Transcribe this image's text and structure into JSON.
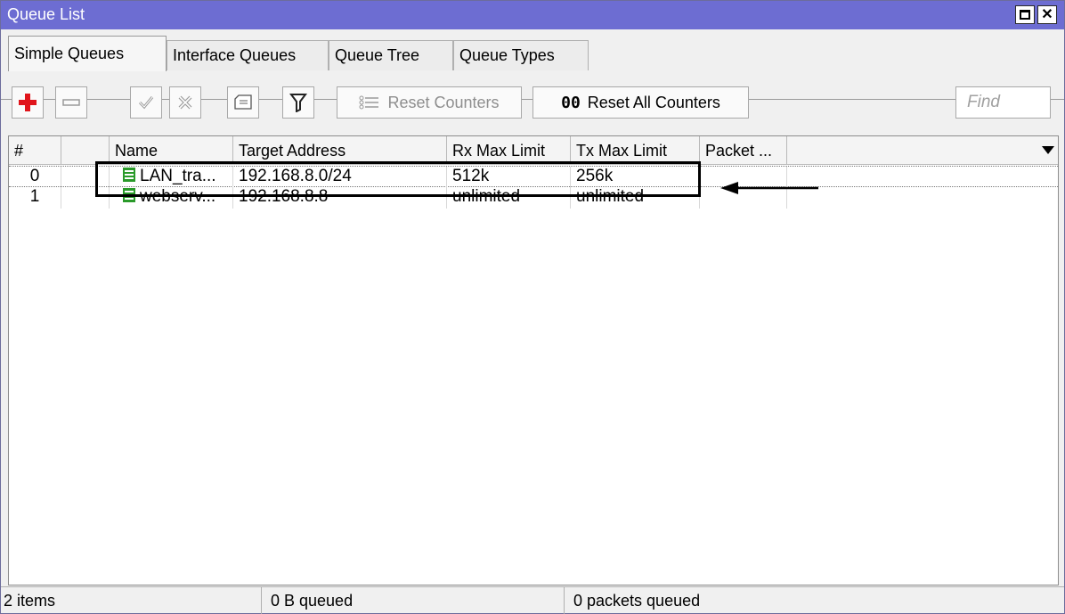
{
  "window": {
    "title": "Queue List"
  },
  "tabs": [
    {
      "label": "Simple Queues",
      "active": true
    },
    {
      "label": "Interface Queues",
      "active": false
    },
    {
      "label": "Queue Tree",
      "active": false
    },
    {
      "label": "Queue Types",
      "active": false
    }
  ],
  "toolbar": {
    "add_icon": "plus-icon",
    "remove_icon": "minus-icon",
    "enable_icon": "check-icon",
    "disable_icon": "cross-icon",
    "comment_icon": "comment-icon",
    "filter_icon": "filter-icon",
    "reset_counters_label": "Reset Counters",
    "reset_all_prefix": "00",
    "reset_all_label": "Reset All Counters",
    "find_placeholder": "Find"
  },
  "table": {
    "columns": [
      "#",
      "",
      "Name",
      "Target Address",
      "Rx Max Limit",
      "Tx Max Limit",
      "Packet ..."
    ],
    "rows": [
      {
        "num": "0",
        "name": "LAN_tra...",
        "target": "192.168.8.0/24",
        "rx": "512k",
        "tx": "256k",
        "packet": ""
      },
      {
        "num": "1",
        "name": "webserv...",
        "target": "192.168.8.8",
        "rx": "unlimited",
        "tx": "unlimited",
        "packet": ""
      }
    ]
  },
  "status": {
    "items": "2 items",
    "queued_bytes": "0 B queued",
    "queued_packets": "0 packets queued"
  },
  "colors": {
    "titlebar": "#6d6dd2",
    "add_icon": "#e0141b",
    "queue_icon": "#2a9a2a"
  }
}
